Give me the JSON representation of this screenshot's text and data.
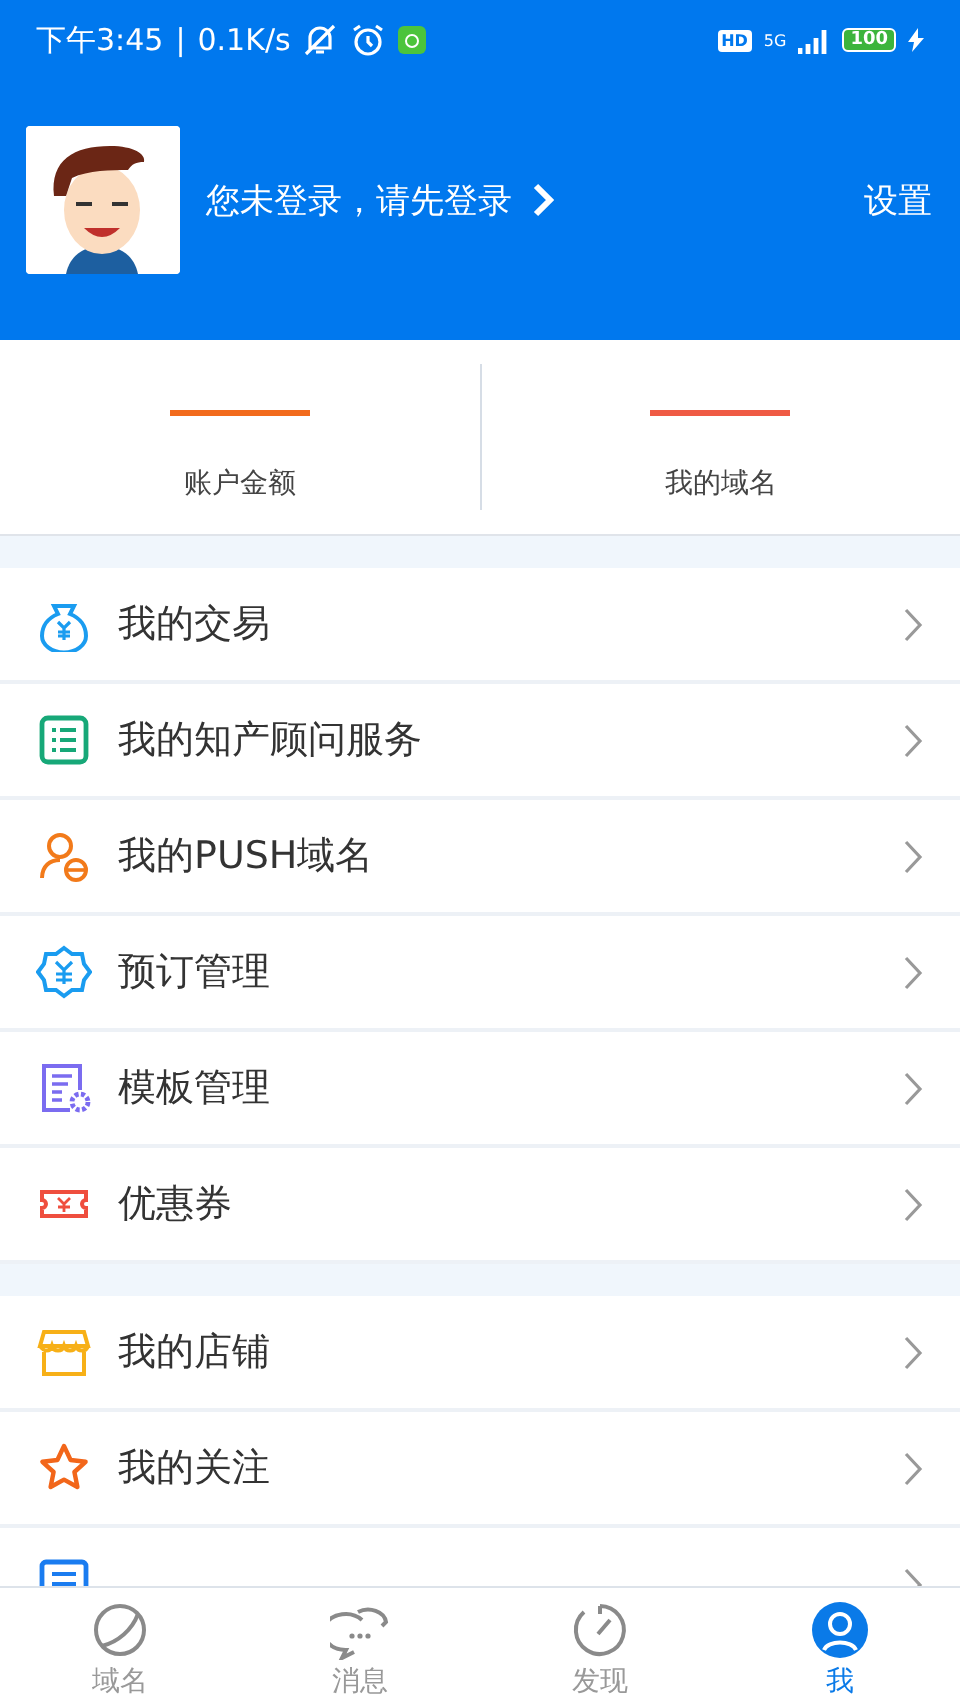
{
  "status_bar": {
    "time": "下午3:45",
    "separator": "|",
    "speed": "0.1K/s",
    "hd": "HD",
    "network": "5G",
    "battery": "100"
  },
  "header": {
    "login_prompt": "您未登录，请先登录",
    "settings": "设置"
  },
  "stats": [
    {
      "label": "账户金额",
      "color": "#f26b1d"
    },
    {
      "label": "我的域名",
      "color": "#ef5a44"
    }
  ],
  "menu_groups": [
    [
      {
        "label": "我的交易",
        "kind": "money-bag"
      },
      {
        "label": "我的知产顾问服务",
        "kind": "list"
      },
      {
        "label": "我的PUSH域名",
        "kind": "user-push"
      },
      {
        "label": "预订管理",
        "kind": "badge-yen"
      },
      {
        "label": "模板管理",
        "kind": "template"
      },
      {
        "label": "优惠券",
        "kind": "coupon"
      }
    ],
    [
      {
        "label": "我的店铺",
        "kind": "shop"
      },
      {
        "label": "我的关注",
        "kind": "star"
      },
      {
        "kind": "feedback"
      }
    ]
  ],
  "tab_bar": [
    {
      "label": "域名",
      "kind": "planet",
      "selected": false
    },
    {
      "label": "消息",
      "kind": "chat",
      "selected": false
    },
    {
      "label": "发现",
      "kind": "gauge",
      "selected": false
    },
    {
      "label": "我",
      "kind": "person",
      "selected": true
    }
  ]
}
